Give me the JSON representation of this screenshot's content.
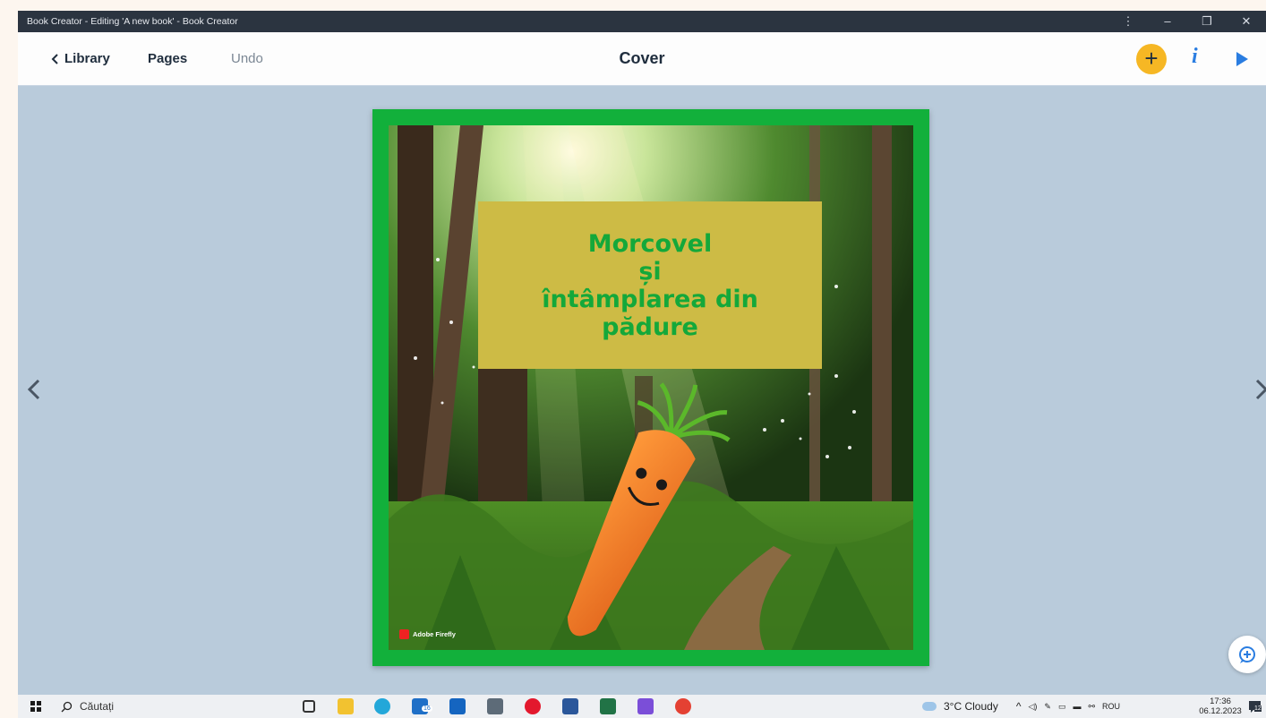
{
  "window": {
    "title": "Book Creator - Editing 'A new book' - Book Creator"
  },
  "toolbar": {
    "library_label": "Library",
    "pages_label": "Pages",
    "undo_label": "Undo",
    "page_title": "Cover",
    "add_icon": "plus-icon",
    "info_icon": "info-icon",
    "play_icon": "play-icon"
  },
  "cover": {
    "title_lines": [
      "Morcovel",
      "și",
      "întâmplarea din",
      "pădure"
    ],
    "watermark": "Adobe Firefly",
    "border_color": "#12b03b",
    "title_box_color": "#cdbb45",
    "title_text_color": "#14a83a"
  },
  "taskbar": {
    "search_placeholder": "Căutați",
    "weather": "3°C  Cloudy",
    "language": "ROU",
    "time": "17:36",
    "date": "06.12.2023",
    "notification_count": "12",
    "badge_count": "16"
  }
}
